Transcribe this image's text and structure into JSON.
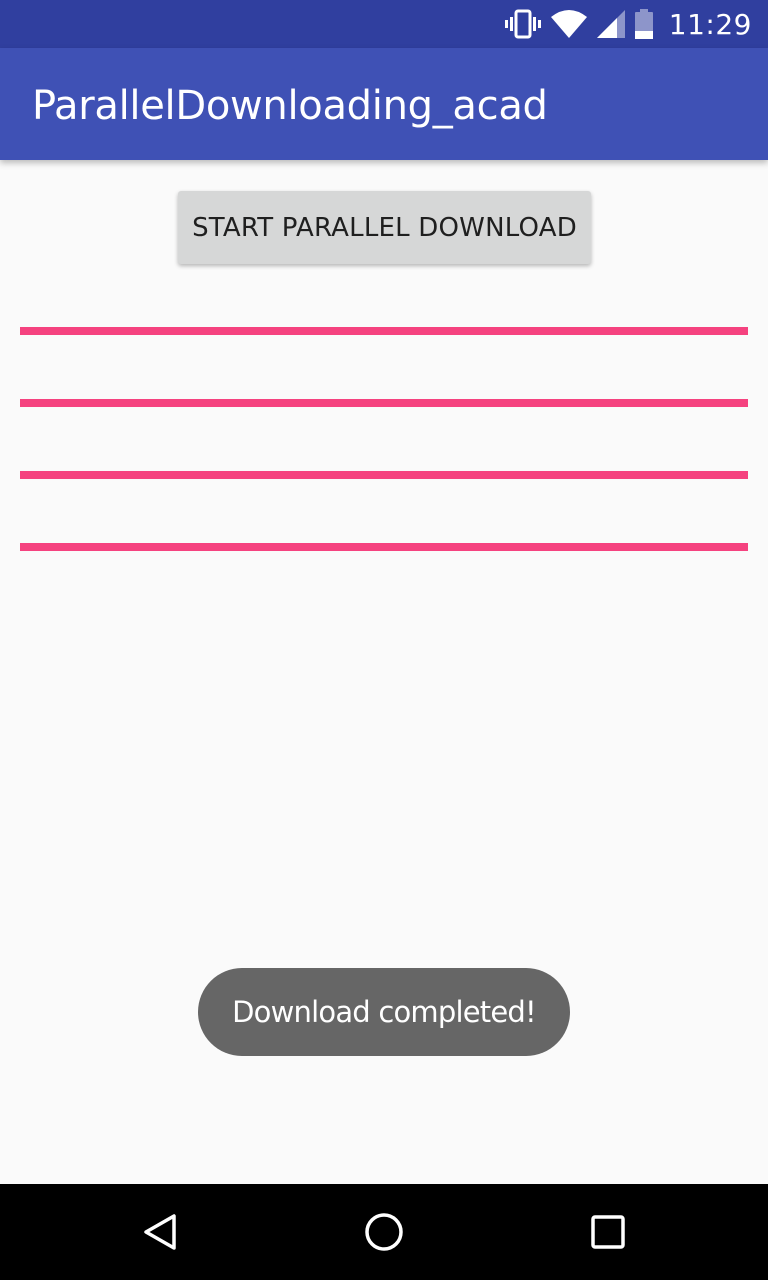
{
  "status_bar": {
    "time": "11:29",
    "icons": [
      "vibrate-icon",
      "wifi-icon",
      "cell-signal-icon",
      "battery-icon"
    ],
    "background": "#303f9f"
  },
  "app_bar": {
    "title": "ParallelDownloading_acad",
    "background": "#3f51b5"
  },
  "main": {
    "start_button_label": "START PARALLEL DOWNLOAD",
    "progress_bars": [
      {
        "progress": 1.0
      },
      {
        "progress": 1.0
      },
      {
        "progress": 1.0
      },
      {
        "progress": 1.0
      }
    ],
    "progress_color": "#f5427f"
  },
  "toast": {
    "message": "Download completed!"
  },
  "nav_bar": {
    "buttons": [
      "back-icon",
      "home-icon",
      "recents-icon"
    ]
  }
}
